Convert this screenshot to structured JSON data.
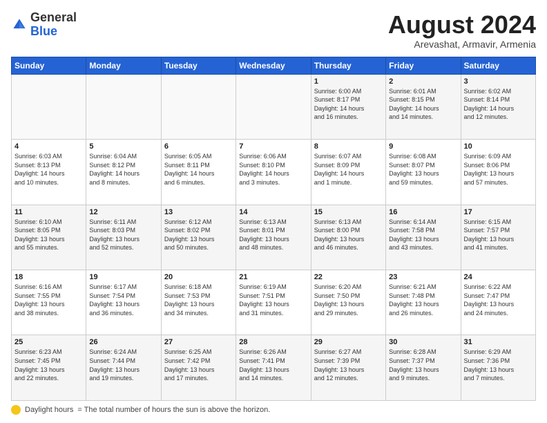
{
  "logo": {
    "general": "General",
    "blue": "Blue"
  },
  "title": "August 2024",
  "location": "Arevashat, Armavir, Armenia",
  "days_header": [
    "Sunday",
    "Monday",
    "Tuesday",
    "Wednesday",
    "Thursday",
    "Friday",
    "Saturday"
  ],
  "weeks": [
    [
      {
        "day": "",
        "info": ""
      },
      {
        "day": "",
        "info": ""
      },
      {
        "day": "",
        "info": ""
      },
      {
        "day": "",
        "info": ""
      },
      {
        "day": "1",
        "info": "Sunrise: 6:00 AM\nSunset: 8:17 PM\nDaylight: 14 hours\nand 16 minutes."
      },
      {
        "day": "2",
        "info": "Sunrise: 6:01 AM\nSunset: 8:15 PM\nDaylight: 14 hours\nand 14 minutes."
      },
      {
        "day": "3",
        "info": "Sunrise: 6:02 AM\nSunset: 8:14 PM\nDaylight: 14 hours\nand 12 minutes."
      }
    ],
    [
      {
        "day": "4",
        "info": "Sunrise: 6:03 AM\nSunset: 8:13 PM\nDaylight: 14 hours\nand 10 minutes."
      },
      {
        "day": "5",
        "info": "Sunrise: 6:04 AM\nSunset: 8:12 PM\nDaylight: 14 hours\nand 8 minutes."
      },
      {
        "day": "6",
        "info": "Sunrise: 6:05 AM\nSunset: 8:11 PM\nDaylight: 14 hours\nand 6 minutes."
      },
      {
        "day": "7",
        "info": "Sunrise: 6:06 AM\nSunset: 8:10 PM\nDaylight: 14 hours\nand 3 minutes."
      },
      {
        "day": "8",
        "info": "Sunrise: 6:07 AM\nSunset: 8:09 PM\nDaylight: 14 hours\nand 1 minute."
      },
      {
        "day": "9",
        "info": "Sunrise: 6:08 AM\nSunset: 8:07 PM\nDaylight: 13 hours\nand 59 minutes."
      },
      {
        "day": "10",
        "info": "Sunrise: 6:09 AM\nSunset: 8:06 PM\nDaylight: 13 hours\nand 57 minutes."
      }
    ],
    [
      {
        "day": "11",
        "info": "Sunrise: 6:10 AM\nSunset: 8:05 PM\nDaylight: 13 hours\nand 55 minutes."
      },
      {
        "day": "12",
        "info": "Sunrise: 6:11 AM\nSunset: 8:03 PM\nDaylight: 13 hours\nand 52 minutes."
      },
      {
        "day": "13",
        "info": "Sunrise: 6:12 AM\nSunset: 8:02 PM\nDaylight: 13 hours\nand 50 minutes."
      },
      {
        "day": "14",
        "info": "Sunrise: 6:13 AM\nSunset: 8:01 PM\nDaylight: 13 hours\nand 48 minutes."
      },
      {
        "day": "15",
        "info": "Sunrise: 6:13 AM\nSunset: 8:00 PM\nDaylight: 13 hours\nand 46 minutes."
      },
      {
        "day": "16",
        "info": "Sunrise: 6:14 AM\nSunset: 7:58 PM\nDaylight: 13 hours\nand 43 minutes."
      },
      {
        "day": "17",
        "info": "Sunrise: 6:15 AM\nSunset: 7:57 PM\nDaylight: 13 hours\nand 41 minutes."
      }
    ],
    [
      {
        "day": "18",
        "info": "Sunrise: 6:16 AM\nSunset: 7:55 PM\nDaylight: 13 hours\nand 38 minutes."
      },
      {
        "day": "19",
        "info": "Sunrise: 6:17 AM\nSunset: 7:54 PM\nDaylight: 13 hours\nand 36 minutes."
      },
      {
        "day": "20",
        "info": "Sunrise: 6:18 AM\nSunset: 7:53 PM\nDaylight: 13 hours\nand 34 minutes."
      },
      {
        "day": "21",
        "info": "Sunrise: 6:19 AM\nSunset: 7:51 PM\nDaylight: 13 hours\nand 31 minutes."
      },
      {
        "day": "22",
        "info": "Sunrise: 6:20 AM\nSunset: 7:50 PM\nDaylight: 13 hours\nand 29 minutes."
      },
      {
        "day": "23",
        "info": "Sunrise: 6:21 AM\nSunset: 7:48 PM\nDaylight: 13 hours\nand 26 minutes."
      },
      {
        "day": "24",
        "info": "Sunrise: 6:22 AM\nSunset: 7:47 PM\nDaylight: 13 hours\nand 24 minutes."
      }
    ],
    [
      {
        "day": "25",
        "info": "Sunrise: 6:23 AM\nSunset: 7:45 PM\nDaylight: 13 hours\nand 22 minutes."
      },
      {
        "day": "26",
        "info": "Sunrise: 6:24 AM\nSunset: 7:44 PM\nDaylight: 13 hours\nand 19 minutes."
      },
      {
        "day": "27",
        "info": "Sunrise: 6:25 AM\nSunset: 7:42 PM\nDaylight: 13 hours\nand 17 minutes."
      },
      {
        "day": "28",
        "info": "Sunrise: 6:26 AM\nSunset: 7:41 PM\nDaylight: 13 hours\nand 14 minutes."
      },
      {
        "day": "29",
        "info": "Sunrise: 6:27 AM\nSunset: 7:39 PM\nDaylight: 13 hours\nand 12 minutes."
      },
      {
        "day": "30",
        "info": "Sunrise: 6:28 AM\nSunset: 7:37 PM\nDaylight: 13 hours\nand 9 minutes."
      },
      {
        "day": "31",
        "info": "Sunrise: 6:29 AM\nSunset: 7:36 PM\nDaylight: 13 hours\nand 7 minutes."
      }
    ]
  ],
  "footer": {
    "daylight_label": "Daylight hours"
  }
}
